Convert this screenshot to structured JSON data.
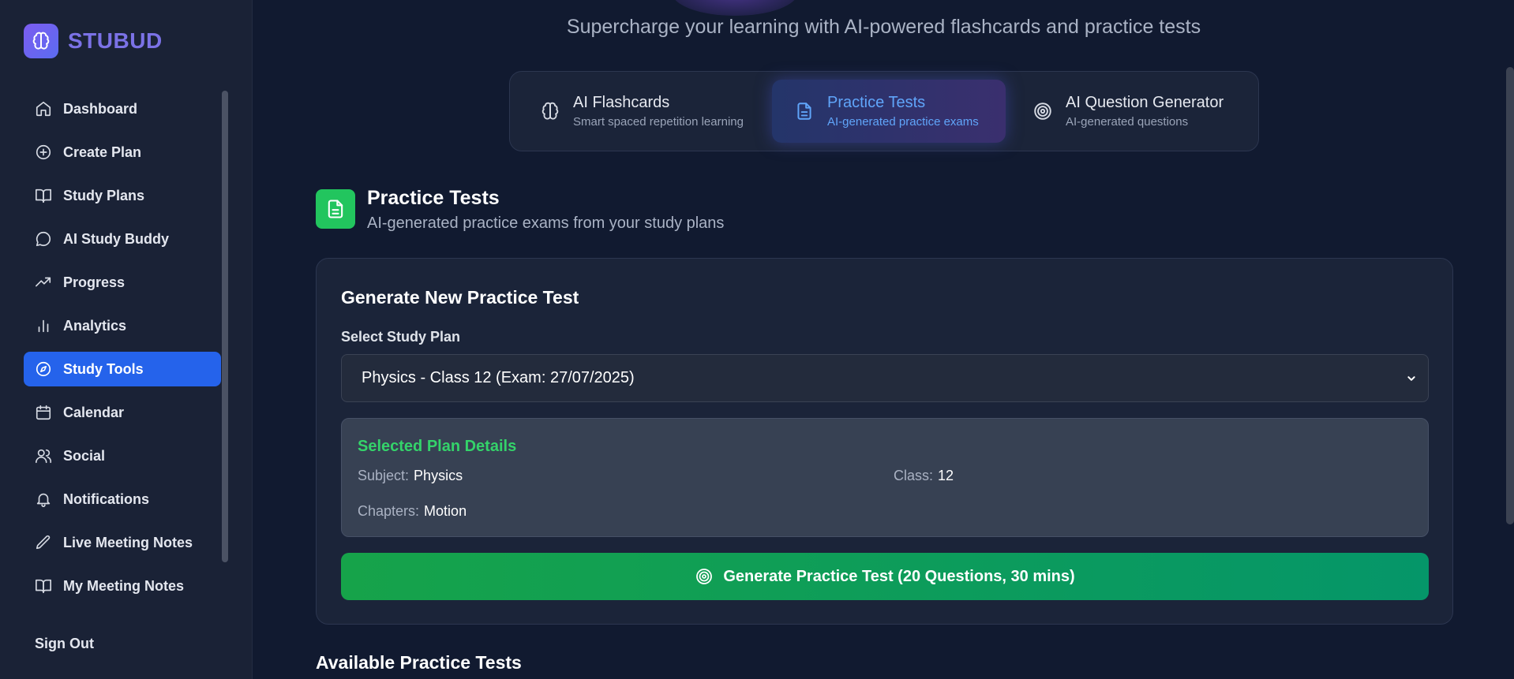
{
  "app": {
    "name": "STUBUD"
  },
  "sidebar": {
    "items": [
      {
        "label": "Dashboard",
        "icon": "home-icon"
      },
      {
        "label": "Create Plan",
        "icon": "plus-circle-icon"
      },
      {
        "label": "Study Plans",
        "icon": "book-open-icon"
      },
      {
        "label": "AI Study Buddy",
        "icon": "chat-bubble-icon"
      },
      {
        "label": "Progress",
        "icon": "trending-up-icon"
      },
      {
        "label": "Analytics",
        "icon": "bar-chart-icon"
      },
      {
        "label": "Study Tools",
        "icon": "compass-icon",
        "active": true
      },
      {
        "label": "Calendar",
        "icon": "calendar-icon"
      },
      {
        "label": "Social",
        "icon": "users-icon"
      },
      {
        "label": "Notifications",
        "icon": "bell-icon"
      },
      {
        "label": "Live Meeting Notes",
        "icon": "pencil-icon"
      },
      {
        "label": "My Meeting Notes",
        "icon": "book-open-icon"
      }
    ],
    "sign_out": "Sign Out"
  },
  "header": {
    "subtitle": "Supercharge your learning with AI-powered flashcards and practice tests"
  },
  "tabs": [
    {
      "title": "AI Flashcards",
      "subtitle": "Smart spaced repetition learning",
      "icon": "brain-icon"
    },
    {
      "title": "Practice Tests",
      "subtitle": "AI-generated practice exams",
      "icon": "document-icon",
      "active": true
    },
    {
      "title": "AI Question Generator",
      "subtitle": "AI-generated questions",
      "icon": "target-icon"
    }
  ],
  "section": {
    "title": "Practice Tests",
    "subtitle": "AI-generated practice exams from your study plans"
  },
  "generate": {
    "title": "Generate New Practice Test",
    "select_label": "Select Study Plan",
    "selected_plan": "Physics - Class 12 (Exam: 27/07/2025)",
    "details_title": "Selected Plan Details",
    "subject_label": "Subject:",
    "subject_value": "Physics",
    "class_label": "Class:",
    "class_value": "12",
    "chapters_label": "Chapters:",
    "chapters_value": "Motion",
    "button_label": "Generate Practice Test (20 Questions, 30 mins)"
  },
  "available": {
    "title": "Available Practice Tests"
  },
  "colors": {
    "accent": "#2563eb",
    "brand": "#7b72e6",
    "success": "#22c55e"
  }
}
